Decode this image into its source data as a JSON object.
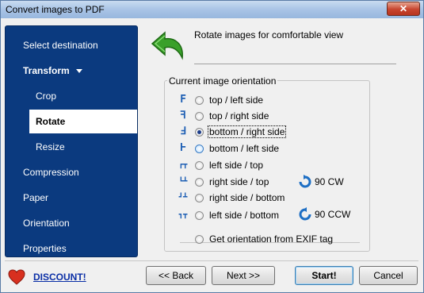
{
  "window": {
    "title": "Convert images to PDF",
    "close_glyph": "✕"
  },
  "sidebar": {
    "items": [
      {
        "label": "Select destination"
      },
      {
        "label": "Transform"
      },
      {
        "label": "Crop"
      },
      {
        "label": "Rotate"
      },
      {
        "label": "Resize"
      },
      {
        "label": "Compression"
      },
      {
        "label": "Paper"
      },
      {
        "label": "Orientation"
      },
      {
        "label": "Properties"
      }
    ],
    "active": "Rotate"
  },
  "header": {
    "text": "Rotate images for comfortable view"
  },
  "orientation": {
    "group_label": "Current image orientation",
    "options": [
      {
        "glyph": "F",
        "label": "top / left side",
        "selected": false
      },
      {
        "glyph": "ꟻ",
        "label": "top / right side",
        "selected": false
      },
      {
        "glyph": "Ⅎ",
        "label": "bottom / right side",
        "selected": true
      },
      {
        "glyph": "Ⱶ",
        "label": "bottom / left side",
        "selected": false
      },
      {
        "glyph": "┏┳",
        "label": "left side / top",
        "selected": false
      },
      {
        "glyph": "┗┻",
        "label": "right side / top",
        "selected": false
      },
      {
        "glyph": "┛┻",
        "label": "right side / bottom",
        "selected": false
      },
      {
        "glyph": "┓┳",
        "label": "left side / bottom",
        "selected": false
      }
    ],
    "exif_label": "Get orientation from EXIF tag",
    "rotate_cw": "90 CW",
    "rotate_ccw": "90 CCW"
  },
  "footer": {
    "discount": "DISCOUNT!",
    "back": "<< Back",
    "next": "Next >>",
    "start": "Start!",
    "cancel": "Cancel"
  },
  "colors": {
    "sidebar_bg": "#0b3a7f",
    "accent_green": "#3aa02a",
    "link": "#0b2fa6"
  }
}
